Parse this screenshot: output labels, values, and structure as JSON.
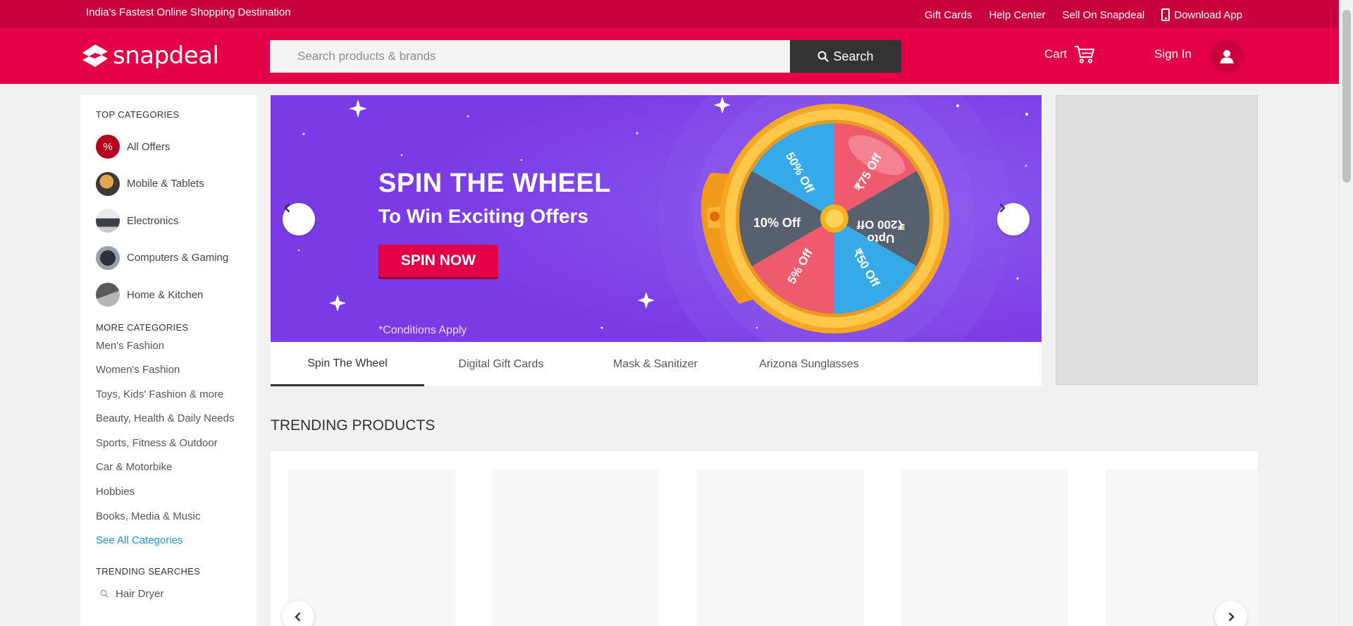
{
  "topbar": {
    "tagline": "India's Fastest Online Shopping Destination",
    "links": [
      "Gift Cards",
      "Help Center",
      "Sell On Snapdeal"
    ],
    "download": "Download App"
  },
  "header": {
    "logo_text": "snapdeal",
    "search_placeholder": "Search products & brands",
    "search_label": "Search",
    "cart_label": "Cart",
    "signin_label": "Sign In"
  },
  "sidebar": {
    "top_title": "TOP CATEGORIES",
    "top_categories": [
      {
        "label": "All Offers",
        "icon": "offers-icon",
        "color": "#b4001e"
      },
      {
        "label": "Mobile & Tablets",
        "icon": "mobile-icon",
        "color": "#c78a3c"
      },
      {
        "label": "Electronics",
        "icon": "electronics-icon",
        "color": "#8a8f99"
      },
      {
        "label": "Computers & Gaming",
        "icon": "computer-icon",
        "color": "#4a4f59"
      },
      {
        "label": "Home & Kitchen",
        "icon": "kitchen-icon",
        "color": "#7c7c7c"
      }
    ],
    "more_title": "MORE CATEGORIES",
    "more_categories": [
      "Men's Fashion",
      "Women's Fashion",
      "Toys, Kids' Fashion & more",
      "Beauty, Health & Daily Needs",
      "Sports, Fitness & Outdoor",
      "Car & Motorbike",
      "Hobbies",
      "Books, Media & Music"
    ],
    "see_all": "See All Categories",
    "trending_title": "TRENDING SEARCHES",
    "trending": [
      "Hair Dryer"
    ]
  },
  "banner": {
    "title": "SPIN THE WHEEL",
    "subtitle": "To Win Exciting Offers",
    "button": "SPIN NOW",
    "conditions": "*Conditions Apply",
    "wheel": [
      "50% Off",
      "₹75 Off",
      "Upto ₹200 Off",
      "₹50 Off",
      "5% Off",
      "10% Off"
    ]
  },
  "banner_tabs": [
    "Spin The Wheel",
    "Digital Gift Cards",
    "Mask & Sanitizer",
    "Arizona Sunglasses"
  ],
  "trending_products_title": "TRENDING PRODUCTS",
  "colors": {
    "brand": "#e40046",
    "topstrip": "#c8003b",
    "search_button": "#333333",
    "link": "#1a94dc",
    "banner_bg": "#7d3fe8"
  }
}
